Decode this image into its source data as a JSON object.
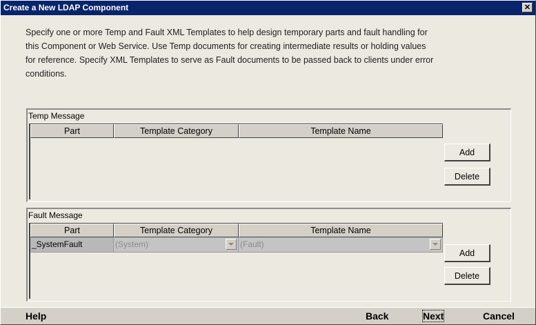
{
  "window": {
    "title": "Create a New LDAP Component",
    "close_glyph": "✕"
  },
  "description": {
    "lines": [
      "Specify one or more Temp and Fault XML Templates to help design temporary parts and fault handling for",
      "this Component or Web Service.  Use Temp documents for creating intermediate results or holding values",
      "for reference. Specify XML Templates to serve as Fault documents to be passed back to clients under error",
      "conditions."
    ]
  },
  "temp_message": {
    "label": "Temp Message",
    "columns": [
      "Part",
      "Template Category",
      "Template Name"
    ],
    "rows": [],
    "add_label": "Add",
    "delete_label": "Delete"
  },
  "fault_message": {
    "label": "Fault Message",
    "columns": [
      "Part",
      "Template Category",
      "Template Name"
    ],
    "rows": [
      {
        "part": "_SystemFault",
        "category": "(System)",
        "name": "(Fault)"
      }
    ],
    "add_label": "Add",
    "delete_label": "Delete"
  },
  "footer": {
    "help_label": "Help",
    "back_label": "Back",
    "next_label": "Next",
    "cancel_label": "Cancel"
  },
  "icons": {
    "close": "close-icon",
    "dropdown": "chevron-down-icon"
  },
  "colors": {
    "titlebar": "#08246b",
    "dialog_bg": "#ece9e1",
    "button_face": "#d4d0c8"
  }
}
